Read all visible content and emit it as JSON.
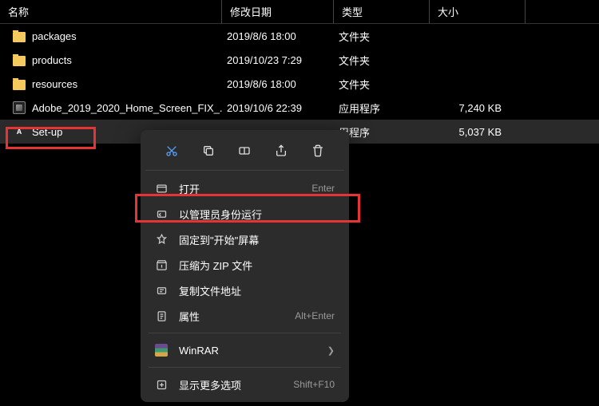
{
  "columns": {
    "name": "名称",
    "date": "修改日期",
    "type": "类型",
    "size": "大小"
  },
  "rows": [
    {
      "name": "packages",
      "date": "2019/8/6 18:00",
      "type": "文件夹",
      "size": "",
      "icon": "folder"
    },
    {
      "name": "products",
      "date": "2019/10/23 7:29",
      "type": "文件夹",
      "size": "",
      "icon": "folder"
    },
    {
      "name": "resources",
      "date": "2019/8/6 18:00",
      "type": "文件夹",
      "size": "",
      "icon": "folder"
    },
    {
      "name": "Adobe_2019_2020_Home_Screen_FIX_...",
      "date": "2019/10/6 22:39",
      "type": "应用程序",
      "size": "7,240 KB",
      "icon": "app"
    },
    {
      "name": "Set-up",
      "date": "",
      "type": "用程序",
      "size": "5,037 KB",
      "icon": "adobe",
      "selected": true
    }
  ],
  "toolbar": {
    "cut": "cut-icon",
    "copy": "copy-icon",
    "rename": "rename-icon",
    "share": "share-icon",
    "delete": "delete-icon"
  },
  "menu": {
    "open": {
      "label": "打开",
      "shortcut": "Enter"
    },
    "runas": {
      "label": "以管理员身份运行"
    },
    "pin": {
      "label": "固定到\"开始\"屏幕"
    },
    "zip": {
      "label": "压缩为 ZIP 文件"
    },
    "copypath": {
      "label": "复制文件地址"
    },
    "props": {
      "label": "属性",
      "shortcut": "Alt+Enter"
    },
    "winrar": {
      "label": "WinRAR"
    },
    "more": {
      "label": "显示更多选项",
      "shortcut": "Shift+F10"
    }
  }
}
